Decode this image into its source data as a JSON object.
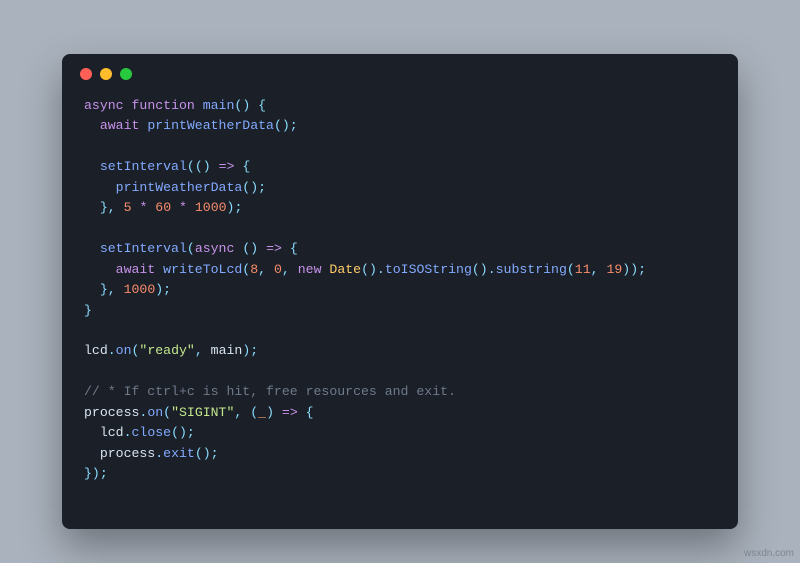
{
  "window": {
    "traffic_lights": [
      "red",
      "yellow",
      "green"
    ]
  },
  "code": {
    "l1": {
      "async": "async",
      "function": "function",
      "name": "main",
      "lp": "(",
      "rp": ")",
      "lb": "{"
    },
    "l2": {
      "indent": "  ",
      "await": "await",
      "fn": "printWeatherData",
      "call": "()",
      "semi": ";"
    },
    "l4": {
      "indent": "  ",
      "fn": "setInterval",
      "lp": "(",
      "args": "()",
      "arrow": "=>",
      "lb": "{"
    },
    "l5": {
      "indent": "    ",
      "fn": "printWeatherData",
      "call": "()",
      "semi": ";"
    },
    "l6": {
      "indent": "  ",
      "rb": "}",
      "comma": ",",
      "n5": "5",
      "mul": "*",
      "n60": "60",
      "n1000": "1000",
      "rp": ")",
      "semi": ";"
    },
    "l8": {
      "indent": "  ",
      "fn": "setInterval",
      "lp": "(",
      "async": "async",
      "args": "()",
      "arrow": "=>",
      "lb": "{"
    },
    "l9": {
      "indent": "    ",
      "await": "await",
      "fn": "writeToLcd",
      "lp": "(",
      "n8": "8",
      "c1": ",",
      "n0": "0",
      "c2": ",",
      "new": "new",
      "cls": "Date",
      "call": "()",
      "dot1": ".",
      "m1": "toISOString",
      "call2": "()",
      "dot2": ".",
      "m2": "substring",
      "lp2": "(",
      "n11": "11",
      "c3": ",",
      "n19": "19",
      "rp2": ")",
      "rp": ")",
      "semi": ";"
    },
    "l10": {
      "indent": "  ",
      "rb": "}",
      "comma": ",",
      "n1000": "1000",
      "rp": ")",
      "semi": ";"
    },
    "l11": {
      "rb": "}"
    },
    "l13": {
      "id": "lcd",
      "dot": ".",
      "fn": "on",
      "lp": "(",
      "str": "\"ready\"",
      "comma": ",",
      "arg": "main",
      "rp": ")",
      "semi": ";"
    },
    "l15": {
      "text": "// * If ctrl+c is hit, free resources and exit."
    },
    "l16": {
      "id": "process",
      "dot": ".",
      "fn": "on",
      "lp": "(",
      "str": "\"SIGINT\"",
      "comma": ",",
      "lpar": "(",
      "param": "_",
      "rpar": ")",
      "arrow": "=>",
      "lb": "{"
    },
    "l17": {
      "indent": "  ",
      "id": "lcd",
      "dot": ".",
      "fn": "close",
      "call": "()",
      "semi": ";"
    },
    "l18": {
      "indent": "  ",
      "id": "process",
      "dot": ".",
      "fn": "exit",
      "call": "()",
      "semi": ";"
    },
    "l19": {
      "rb": "}",
      "rp": ")",
      "semi": ";"
    }
  },
  "watermark": "wsxdn.com"
}
